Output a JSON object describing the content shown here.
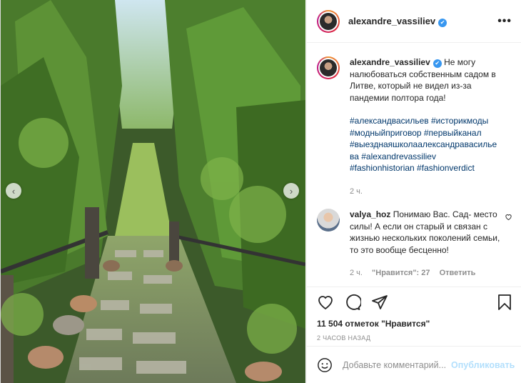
{
  "post": {
    "username": "alexandre_vassiliev",
    "more_label": "•••",
    "caption": "Не могу налюбоваться собственным садом в Литве, который не видел из-за пандемии полтора года!",
    "hashtags": "#александвасильев #историкмоды #модныйприговор #первыйканал #выезднаяшколаалександравасилье ва #alexandrevassiliev #fashionhistorian #fashionverdict",
    "caption_time": "2 ч.",
    "likes": "11 504 отметок \"Нравится\"",
    "posted_ago": "2 часов назад"
  },
  "comment": {
    "username": "valya_hoz",
    "text": "Понимаю Вас. Сад- место силы! А если он старый и связан с жизнью нескольких поколений семьи, то это вообще бесценно!",
    "time": "2 ч.",
    "likes": "\"Нравится\": 27",
    "reply": "Ответить"
  },
  "add_comment": {
    "placeholder": "Добавьте комментарий...",
    "publish": "Опубликовать"
  },
  "icons": {
    "verified": "verified-badge-icon",
    "like": "heart-icon",
    "comment": "comment-bubble-icon",
    "share": "paper-plane-icon",
    "save": "bookmark-icon",
    "emoji": "smiley-icon",
    "prev": "chevron-left-icon",
    "next": "chevron-right-icon"
  },
  "colors": {
    "link": "#00376b",
    "verified": "#3897f0",
    "publish": "#b2dffc",
    "muted": "#8e8e8e"
  },
  "nav": {
    "prev": "‹",
    "next": "›"
  }
}
